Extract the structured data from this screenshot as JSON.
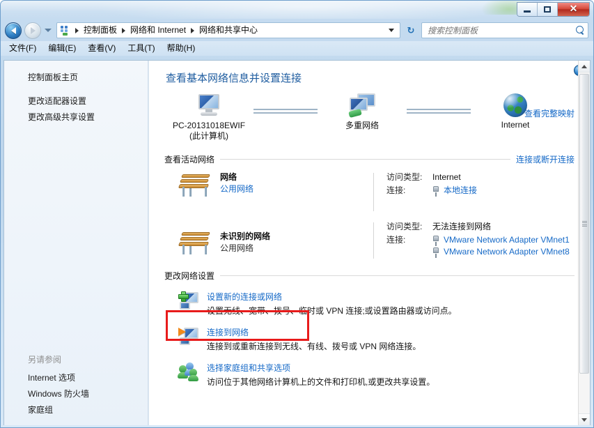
{
  "window": {
    "controls": {
      "minimize": "–",
      "maximize": "□",
      "close": "✕"
    }
  },
  "navigation": {
    "back_tooltip": "后退",
    "forward_tooltip": "前进",
    "breadcrumbs": [
      "控制面板",
      "网络和 Internet",
      "网络和共享中心"
    ],
    "refresh_label": "↻"
  },
  "search": {
    "placeholder": "搜索控制面板",
    "value": ""
  },
  "menubar": {
    "items": [
      "文件(F)",
      "编辑(E)",
      "查看(V)",
      "工具(T)",
      "帮助(H)"
    ]
  },
  "sidebar": {
    "home_label": "控制面板主页",
    "items": [
      "更改适配器设置",
      "更改高级共享设置"
    ],
    "see_also_heading": "另请参阅",
    "see_also_items": [
      "Internet 选项",
      "Windows 防火墙",
      "家庭组"
    ]
  },
  "main": {
    "help_glyph": "?",
    "page_title": "查看基本网络信息并设置连接",
    "network_map": {
      "full_map_link": "查看完整映射",
      "nodes": [
        {
          "label": "PC-20131018EWIF",
          "sublabel": "(此计算机)",
          "icon": "computer-icon"
        },
        {
          "label": "多重网络",
          "sublabel": "",
          "icon": "multiple-networks-icon"
        },
        {
          "label": "Internet",
          "sublabel": "",
          "icon": "globe-icon"
        }
      ]
    },
    "active_networks": {
      "section_title": "查看活动网络",
      "section_link": "连接或断开连接",
      "label_access_type": "访问类型:",
      "label_connections": "连接:",
      "networks": [
        {
          "name": "网络",
          "type": "公用网络",
          "access_type": "Internet",
          "connections": [
            "本地连接"
          ]
        },
        {
          "name": "未识别的网络",
          "type": "公用网络",
          "access_type": "无法连接到网络",
          "connections": [
            "VMware Network Adapter VMnet1",
            "VMware Network Adapter VMnet8"
          ]
        }
      ]
    },
    "change_settings": {
      "section_title": "更改网络设置",
      "items": [
        {
          "title": "设置新的连接或网络",
          "desc": "设置无线、宽带、拨号、临时或 VPN 连接;或设置路由器或访问点。",
          "icon": "new-connection-icon",
          "highlighted": true
        },
        {
          "title": "连接到网络",
          "desc": "连接到或重新连接到无线、有线、拨号或 VPN 网络连接。",
          "icon": "connect-network-icon",
          "highlighted": false
        },
        {
          "title": "选择家庭组和共享选项",
          "desc": "访问位于其他网络计算机上的文件和打印机,或更改共享设置。",
          "icon": "homegroup-icon",
          "highlighted": false
        }
      ]
    }
  },
  "colors": {
    "link": "#1569c7",
    "title": "#1f5da0",
    "highlight_box": "#e81b1b",
    "window_border": "#6f9fcc"
  }
}
